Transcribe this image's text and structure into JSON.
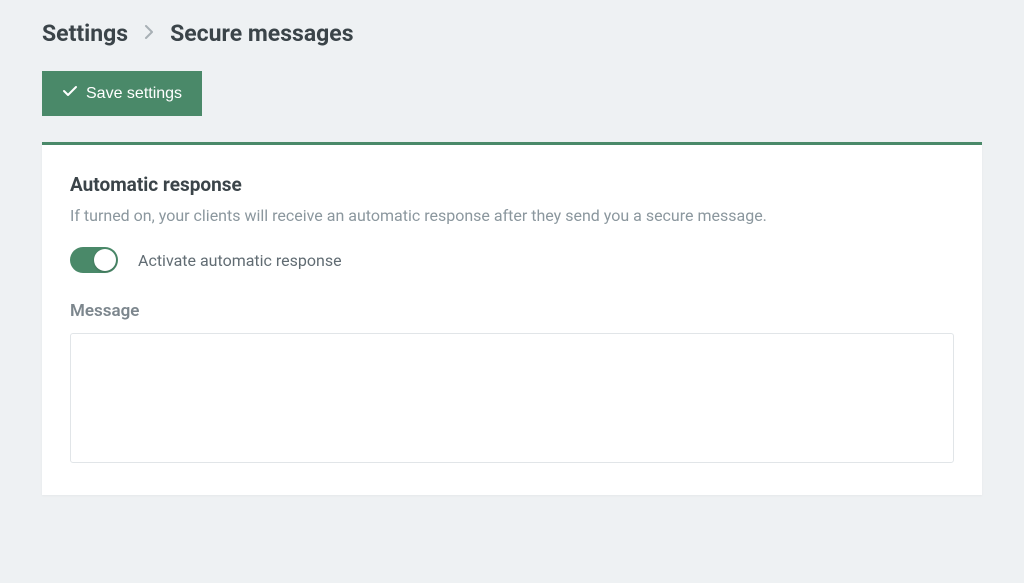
{
  "breadcrumb": {
    "root": "Settings",
    "current": "Secure messages"
  },
  "actions": {
    "save_label": "Save settings"
  },
  "card": {
    "title": "Automatic response",
    "description": "If turned on, your clients will receive an automatic response after they send you a secure message.",
    "toggle_label": "Activate automatic response",
    "toggle_state": true,
    "message_label": "Message",
    "message_value": ""
  }
}
